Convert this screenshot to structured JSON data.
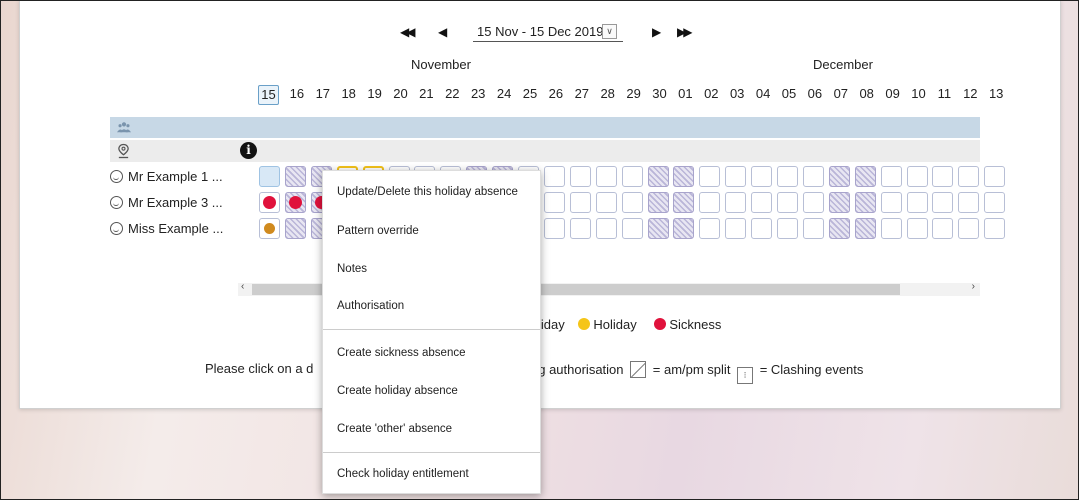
{
  "calendar": {
    "nav": {
      "first": "◀◀",
      "prev": "◀",
      "next": "▶",
      "last": "▶▶"
    },
    "date_range": "15 Nov - 15 Dec 2019",
    "months": [
      "November",
      "December"
    ],
    "days": [
      "15",
      "16",
      "17",
      "18",
      "19",
      "20",
      "21",
      "22",
      "23",
      "24",
      "25",
      "26",
      "27",
      "28",
      "29",
      "30",
      "01",
      "02",
      "03",
      "04",
      "05",
      "06",
      "07",
      "08",
      "09",
      "10",
      "11",
      "12",
      "13"
    ],
    "selected_day": "15",
    "group_icon": "group-people-icon",
    "location_icon": "location-pin-icon",
    "info_icon": "i"
  },
  "employees": [
    {
      "name": "Mr Example 1 ..."
    },
    {
      "name": "Mr Example 3 ..."
    },
    {
      "name": "Miss Example ..."
    }
  ],
  "legend": {
    "partial_label": "liday",
    "holiday_label": "Holiday",
    "sickness_label": "Sickness",
    "holiday_color": "#f5c518",
    "sickness_color": "#e0123c"
  },
  "footnote": {
    "left": "Please click on a d",
    "right_part1": "ng authorisation",
    "right_part2": "= am/pm split",
    "right_part3": "= Clashing events"
  },
  "context_menu": {
    "items": [
      "Update/Delete this holiday absence",
      "Pattern override",
      "Notes",
      "Authorisation",
      "Create sickness absence",
      "Create holiday absence",
      "Create 'other' absence",
      "Check holiday entitlement"
    ]
  }
}
